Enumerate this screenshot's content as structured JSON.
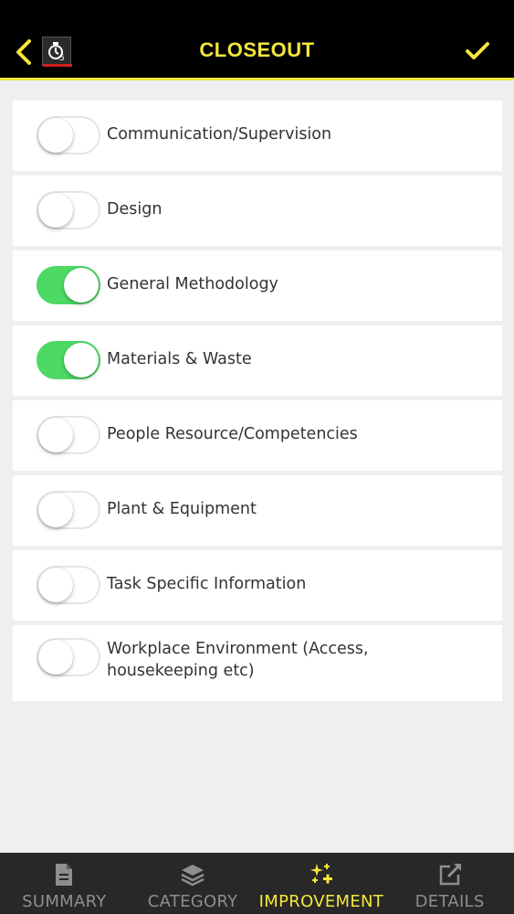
{
  "header": {
    "title": "CLOSEOUT",
    "accent_color": "#f4e73a",
    "back_icon": "chevron-left-icon",
    "logo_icon": "app-logo-icon",
    "confirm_icon": "checkmark-icon"
  },
  "categories": [
    {
      "label": "Communication/Supervision",
      "enabled": false
    },
    {
      "label": "Design",
      "enabled": false
    },
    {
      "label": "General Methodology",
      "enabled": true
    },
    {
      "label": "Materials & Waste",
      "enabled": true
    },
    {
      "label": "People Resource/Competencies",
      "enabled": false
    },
    {
      "label": "Plant & Equipment",
      "enabled": false
    },
    {
      "label": "Task Specific Information",
      "enabled": false
    },
    {
      "label": "Workplace Environment (Access, housekeeping etc)",
      "enabled": false
    }
  ],
  "toggle_on_color": "#4cd964",
  "tabs": [
    {
      "label": "SUMMARY",
      "icon": "document-icon",
      "active": false
    },
    {
      "label": "CATEGORY",
      "icon": "layers-icon",
      "active": false
    },
    {
      "label": "IMPROVEMENT",
      "icon": "sparkle-plus-icon",
      "active": true
    },
    {
      "label": "DETAILS",
      "icon": "external-edit-icon",
      "active": false
    }
  ]
}
